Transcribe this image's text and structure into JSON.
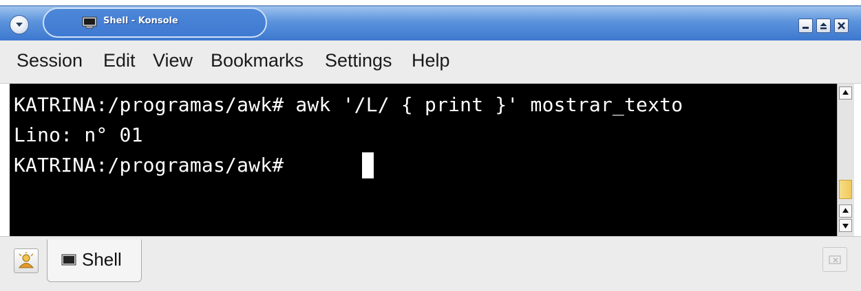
{
  "window": {
    "title": "Shell - Konsole"
  },
  "menubar": {
    "items": [
      "Session",
      "Edit",
      "View",
      "Bookmarks",
      "Settings",
      "Help"
    ]
  },
  "terminal": {
    "lines": [
      "KATRINA:/programas/awk# awk '/L/ { print }' mostrar_texto",
      "Lino: n° 01",
      "KATRINA:/programas/awk# "
    ],
    "background": "#000000",
    "foreground": "#ffffff"
  },
  "tabs": [
    {
      "label": "Shell",
      "icon": "terminal-icon"
    }
  ],
  "icons": {
    "window_menu": "chevron-down-icon",
    "minimize": "minimize-icon",
    "maximize": "maximize-icon",
    "close": "close-icon",
    "new_tab": "new-session-icon",
    "close_tab": "close-tab-icon"
  },
  "colors": {
    "titlebar": "#4a86d6",
    "menubar": "#ececec",
    "scroll_thumb": "#f1c95a"
  }
}
